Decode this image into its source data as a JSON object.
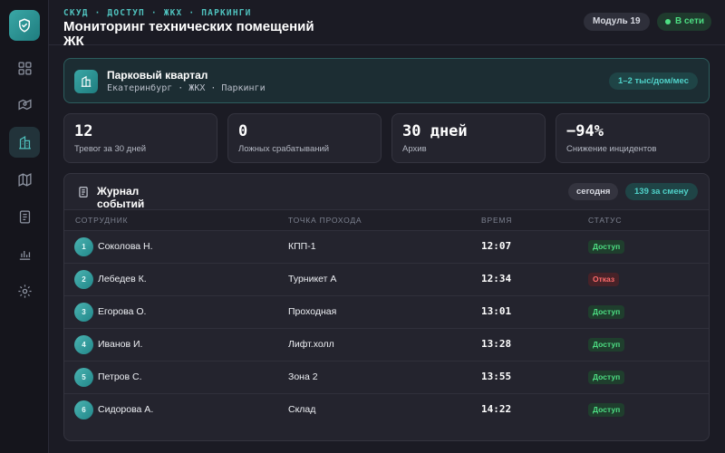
{
  "header": {
    "kicker": "СКУД · ДОСТУП · ЖКХ · ПАРКИНГИ",
    "title": "Мониторинг технических помещений ЖК",
    "module": "Модуль 19",
    "status": "В сети"
  },
  "sidebar": {
    "items": [
      {
        "icon": "dashboard-icon"
      },
      {
        "icon": "map-pin-icon"
      },
      {
        "icon": "building-icon",
        "active": true
      },
      {
        "icon": "map-icon"
      },
      {
        "icon": "document-icon"
      },
      {
        "icon": "chart-icon"
      },
      {
        "icon": "gear-icon"
      }
    ]
  },
  "banner": {
    "title": "Парковый квартал",
    "subtitle": "Екатеринбург · ЖКХ · Паркинги",
    "price": "1–2 тыс/дом/мес"
  },
  "stats": [
    {
      "value": "12",
      "label": "Тревог за 30 дней"
    },
    {
      "value": "0",
      "label": "Ложных срабатываний"
    },
    {
      "value": "30 дней",
      "label": "Архив"
    },
    {
      "value": "−94%",
      "label": "Снижение инцидентов"
    }
  ],
  "journal": {
    "title": "Журнал событий",
    "filter_today": "сегодня",
    "shift_count": "139 за смену",
    "columns": [
      "СОТРУДНИК",
      "ТОЧКА ПРОХОДА",
      "ВРЕМЯ",
      "СТАТУС"
    ],
    "rows": [
      {
        "num": "1",
        "name": "Соколова Н.",
        "point": "КПП-1",
        "time": "12:07",
        "status": "Доступ",
        "kind": "ok"
      },
      {
        "num": "2",
        "name": "Лебедев К.",
        "point": "Турникет А",
        "time": "12:34",
        "status": "Отказ",
        "kind": "deny"
      },
      {
        "num": "3",
        "name": "Егорова О.",
        "point": "Проходная",
        "time": "13:01",
        "status": "Доступ",
        "kind": "ok"
      },
      {
        "num": "4",
        "name": "Иванов И.",
        "point": "Лифт.холл",
        "time": "13:28",
        "status": "Доступ",
        "kind": "ok"
      },
      {
        "num": "5",
        "name": "Петров С.",
        "point": "Зона 2",
        "time": "13:55",
        "status": "Доступ",
        "kind": "ok"
      },
      {
        "num": "6",
        "name": "Сидорова А.",
        "point": "Склад",
        "time": "14:22",
        "status": "Доступ",
        "kind": "ok"
      }
    ]
  },
  "colors": {
    "accent": "#4fc1bd",
    "ok": "#4ddf83",
    "deny": "#ff6b6b"
  }
}
